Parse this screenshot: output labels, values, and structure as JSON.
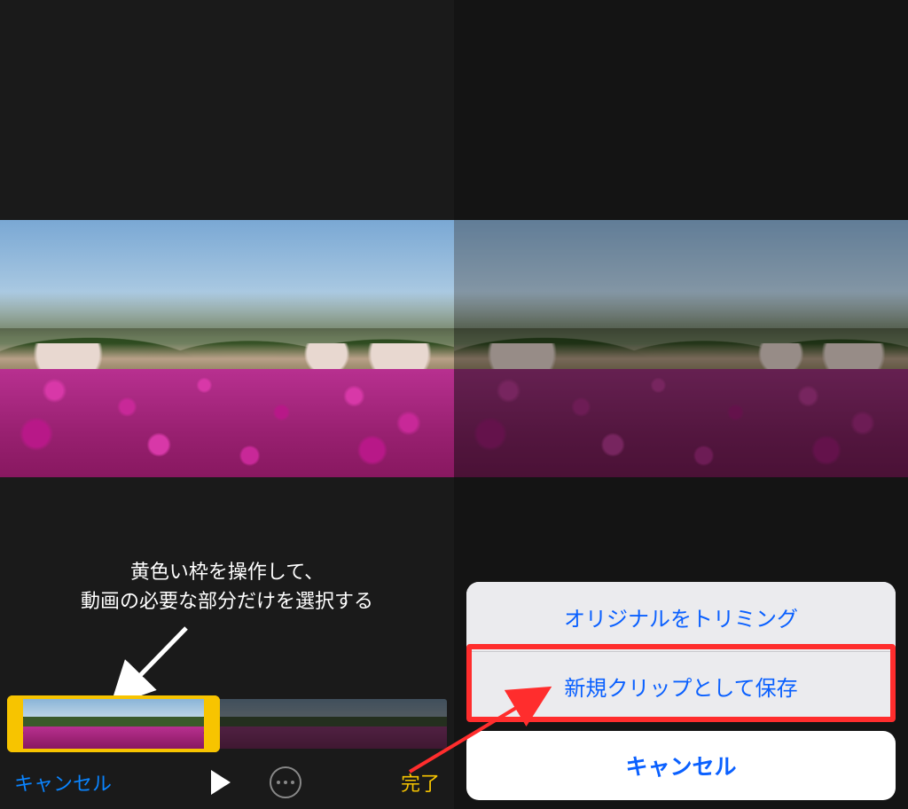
{
  "left": {
    "annotation_line1": "黄色い枠を操作して、",
    "annotation_line2": "動画の必要な部分だけを選択する",
    "toolbar": {
      "cancel": "キャンセル",
      "done": "完了"
    },
    "trim_handle_left_glyph": "〈",
    "trim_handle_right_glyph": "〉"
  },
  "right": {
    "action_sheet": {
      "options": [
        {
          "label": "オリジナルをトリミング"
        },
        {
          "label": "新規クリップとして保存"
        }
      ],
      "cancel": "キャンセル"
    }
  },
  "colors": {
    "accent_blue": "#0a84ff",
    "accent_yellow": "#f7c400",
    "highlight_red": "#ff2d2d"
  }
}
